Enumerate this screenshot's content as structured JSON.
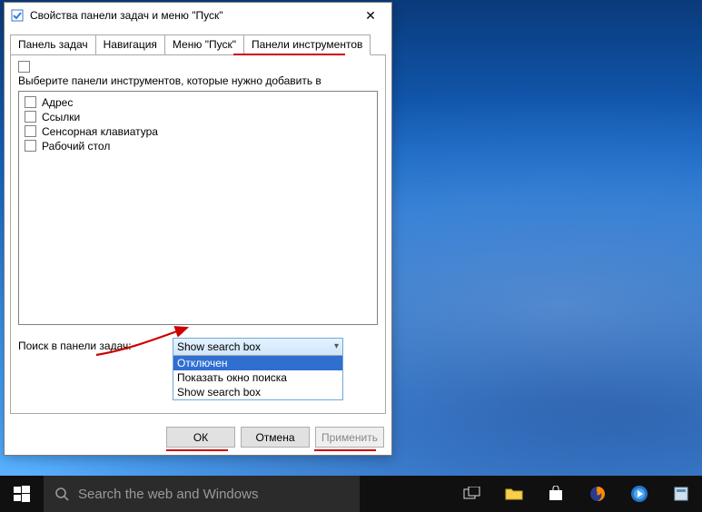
{
  "dialog": {
    "title": "Свойства панели задач и меню \"Пуск\"",
    "tabs": [
      {
        "label": "Панель задач",
        "active": false
      },
      {
        "label": "Навигация",
        "active": false
      },
      {
        "label": "Меню \"Пуск\"",
        "active": false
      },
      {
        "label": "Панели инструментов",
        "active": true
      }
    ],
    "panel": {
      "instruction": "Выберите панели инструментов, которые нужно добавить в",
      "items": [
        {
          "label": "Адрес"
        },
        {
          "label": "Ссылки"
        },
        {
          "label": "Сенсорная клавиатура"
        },
        {
          "label": "Рабочий стол"
        }
      ],
      "search_label": "Поиск в панели задач:",
      "combo": {
        "selected": "Show search box",
        "options": [
          {
            "label": "Отключен",
            "highlighted": true
          },
          {
            "label": "Показать окно поиска",
            "highlighted": false
          },
          {
            "label": "Show search box",
            "highlighted": false
          }
        ]
      }
    },
    "buttons": {
      "ok": "ОК",
      "cancel": "Отмена",
      "apply": "Применить"
    }
  },
  "taskbar": {
    "search_placeholder": "Search the web and Windows"
  }
}
